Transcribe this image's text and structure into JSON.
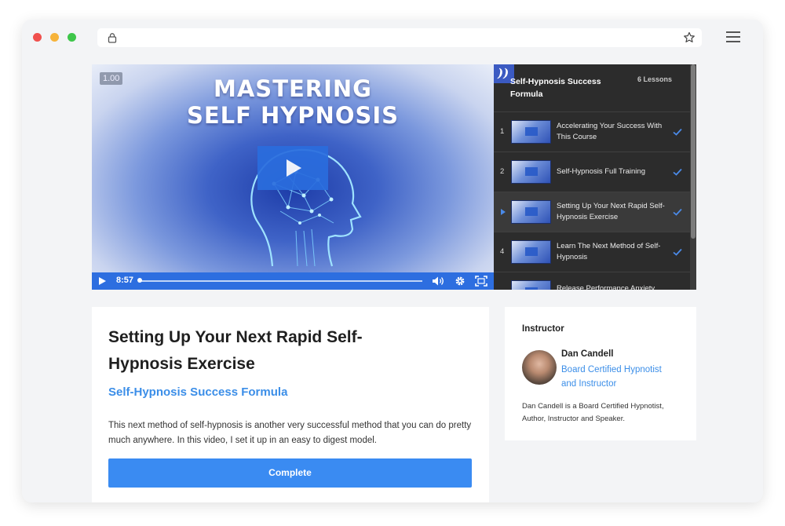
{
  "video": {
    "speed": "1.00",
    "title_line1": "MASTERING",
    "title_line2": "SELF HYPNOSIS",
    "time": "8:57",
    "progress": 0.0
  },
  "playlist": {
    "course_title": "Self-Hypnosis Success Formula",
    "lesson_count": "6 Lessons",
    "lessons": [
      {
        "num": "1",
        "title": "Accelerating Your Success With This Course",
        "completed": true,
        "active": false
      },
      {
        "num": "2",
        "title": "Self-Hypnosis Full Training",
        "completed": true,
        "active": false
      },
      {
        "num": "",
        "title": "Setting Up Your Next Rapid Self-Hypnosis Exercise",
        "completed": true,
        "active": true
      },
      {
        "num": "4",
        "title": "Learn The Next Method of Self-Hypnosis",
        "completed": true,
        "active": false
      },
      {
        "num": "",
        "title": "Release Performance Anxiety FAST",
        "completed": false,
        "active": false
      }
    ]
  },
  "lesson": {
    "title": "Setting Up Your Next Rapid Self-Hypnosis Exercise",
    "course_link": "Self-Hypnosis Success Formula",
    "description": "This next method of self-hypnosis is another very successful method that you can do pretty much anywhere. In this video, I set it up in an easy to digest model.",
    "complete_label": "Complete"
  },
  "instructor": {
    "heading": "Instructor",
    "name": "Dan Candell",
    "role": "Board Certified Hypnotist and Instructor",
    "bio": "Dan Candell is a Board Certified Hypnotist, Author, Instructor and Speaker."
  },
  "colors": {
    "accent": "#3a8bf2",
    "link": "#3b8ee8",
    "playlist_bg": "#2c2c2c",
    "control_bar": "#2d6ee0"
  }
}
